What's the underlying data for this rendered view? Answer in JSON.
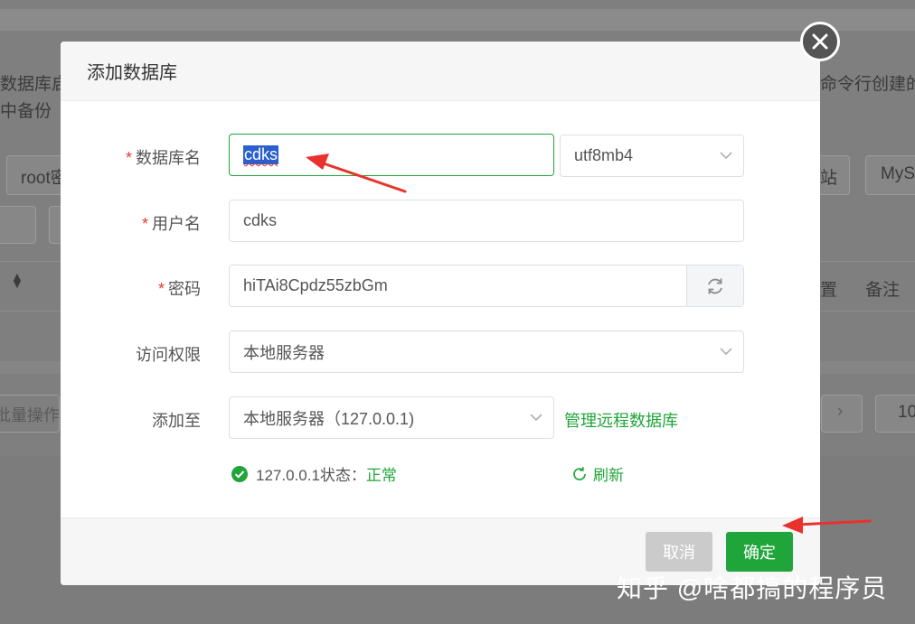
{
  "background": {
    "left_texts": [
      "数据库启",
      "中备份",
      "root密",
      "批量操作"
    ],
    "right_texts": [
      "命令行创建的",
      "站",
      "MyS",
      "置",
      "备注",
      "10"
    ]
  },
  "modal": {
    "title": "添加数据库",
    "fields": {
      "db_name": {
        "label": "数据库名",
        "required": true,
        "value": "cdks"
      },
      "charset": {
        "value": "utf8mb4"
      },
      "username": {
        "label": "用户名",
        "required": true,
        "value": "cdks"
      },
      "password": {
        "label": "密码",
        "required": true,
        "value": "hiTAi8Cpdz55zbGm"
      },
      "access": {
        "label": "访问权限",
        "value": "本地服务器"
      },
      "add_to": {
        "label": "添加至",
        "value": "本地服务器（127.0.0.1)"
      }
    },
    "required_mark": "*",
    "manage_remote_link": "管理远程数据库",
    "status": {
      "prefix": "127.0.0.1状态：",
      "value": "正常"
    },
    "refresh_link": "刷新",
    "buttons": {
      "cancel": "取消",
      "confirm": "确定"
    }
  },
  "watermark": "知乎 @啥都搞的程序员",
  "colors": {
    "accent": "#20a53a",
    "required": "#e53935",
    "annotation_arrow": "#e8322d"
  },
  "icons": [
    "close-icon",
    "chevron-down-icon",
    "regenerate-icon",
    "check-circle-icon",
    "refresh-icon"
  ]
}
